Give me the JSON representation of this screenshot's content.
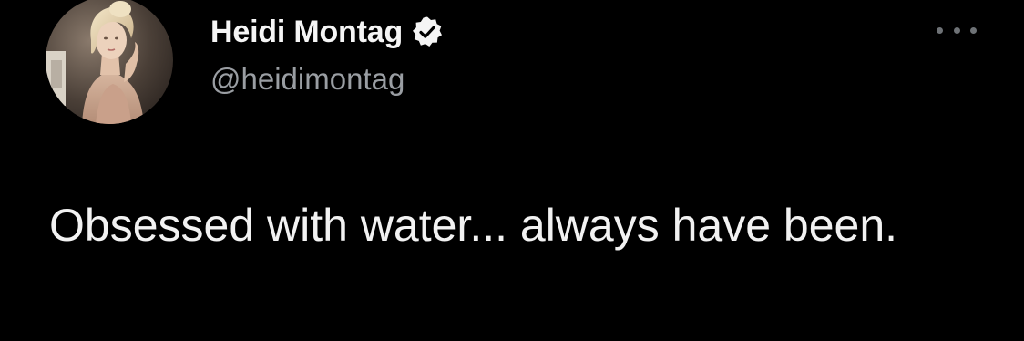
{
  "tweet": {
    "author": {
      "display_name": "Heidi Montag",
      "handle": "@heidimontag",
      "verified": true,
      "avatar_icon": "profile-photo"
    },
    "more_icon": "more-horizontal-icon",
    "text": "Obsessed with water... always have been."
  },
  "colors": {
    "background": "#000000",
    "name": "#f5f5f5",
    "handle": "#9a9ea3",
    "body_text": "#f2f2f2",
    "verified_badge": "#f5f5f5"
  }
}
